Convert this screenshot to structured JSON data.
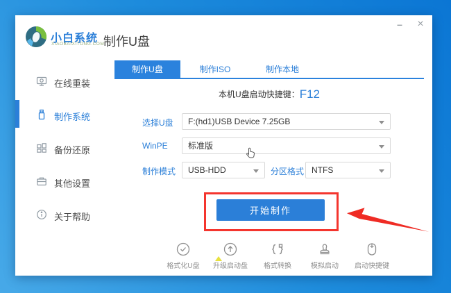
{
  "colors": {
    "accent": "#2b7fd8",
    "tab_blue": "#2b82dd",
    "danger_red": "#f4352e",
    "marker_yellow": "#e8e13e"
  },
  "window_controls": {
    "minimize": "–",
    "close": "×"
  },
  "logo": {
    "name": "小白系统",
    "domain": "XIAOBAIXITONG.COM"
  },
  "header": {
    "title": "制作U盘"
  },
  "sidebar": {
    "items": [
      {
        "label": "在线重装",
        "icon": "monitor-icon",
        "active": false
      },
      {
        "label": "制作系统",
        "icon": "usb-drive-icon",
        "active": true
      },
      {
        "label": "备份还原",
        "icon": "backup-blocks-icon",
        "active": false
      },
      {
        "label": "其他设置",
        "icon": "briefcase-icon",
        "active": false
      },
      {
        "label": "关于帮助",
        "icon": "info-icon",
        "active": false
      }
    ]
  },
  "tabs": [
    {
      "label": "制作U盘",
      "active": true
    },
    {
      "label": "制作ISO",
      "active": false
    },
    {
      "label": "制作本地",
      "active": false
    }
  ],
  "hotkey": {
    "label": "本机U盘启动快捷键：",
    "value": "F12"
  },
  "form": {
    "usb": {
      "label": "选择U盘",
      "value": "F:(hd1)USB Device 7.25GB"
    },
    "winpe": {
      "label": "WinPE",
      "value": "标准版"
    },
    "mode": {
      "label": "制作模式",
      "value": "USB-HDD"
    },
    "partition": {
      "label": "分区格式",
      "value": "NTFS"
    }
  },
  "actions": {
    "start": "开始制作"
  },
  "footer_tools": [
    {
      "label": "格式化U盘",
      "icon": "format-check-icon"
    },
    {
      "label": "升级启动盘",
      "icon": "upgrade-arrow-icon"
    },
    {
      "label": "格式转换",
      "icon": "convert-braces-icon"
    },
    {
      "label": "模拟启动",
      "icon": "stamp-icon"
    },
    {
      "label": "启动快捷键",
      "icon": "mouse-icon"
    }
  ]
}
